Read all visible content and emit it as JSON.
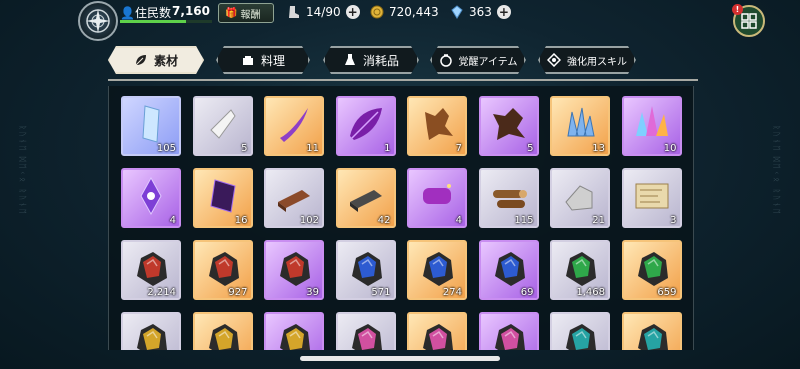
{
  "header": {
    "residents_label": "住民数",
    "residents_value": "7,160",
    "residents_progress": 0.72,
    "reward_label": "報酬",
    "capacity": "14/90",
    "gold": "720,443",
    "gems": "363",
    "notification_badge": "!"
  },
  "tabs": [
    {
      "label": "素材",
      "icon": "leaf-icon"
    },
    {
      "label": "料理",
      "icon": "pot-icon"
    },
    {
      "label": "消耗品",
      "icon": "flask-icon"
    },
    {
      "label": "覚醒アイテム",
      "icon": "awaken-icon"
    },
    {
      "label": "強化用スキル",
      "icon": "skill-icon"
    }
  ],
  "active_tab": 0,
  "items": [
    {
      "name": "crystal-shard",
      "rarity": "blue",
      "count": "105"
    },
    {
      "name": "white-stone",
      "rarity": "white",
      "count": "5"
    },
    {
      "name": "purple-fang",
      "rarity": "orange",
      "count": "11"
    },
    {
      "name": "purple-feather",
      "rarity": "purple",
      "count": "1"
    },
    {
      "name": "brown-pelt",
      "rarity": "orange",
      "count": "7"
    },
    {
      "name": "dark-pelt",
      "rarity": "purple",
      "count": "5"
    },
    {
      "name": "blue-crystals",
      "rarity": "orange",
      "count": "13"
    },
    {
      "name": "rainbow-crystals",
      "rarity": "purple",
      "count": "10"
    },
    {
      "name": "void-gem",
      "rarity": "purple",
      "count": "4"
    },
    {
      "name": "dark-shard",
      "rarity": "orange",
      "count": "16"
    },
    {
      "name": "copper-ingot",
      "rarity": "white",
      "count": "102"
    },
    {
      "name": "iron-ingot",
      "rarity": "orange",
      "count": "42"
    },
    {
      "name": "purple-cloth",
      "rarity": "purple",
      "count": "4"
    },
    {
      "name": "logs",
      "rarity": "white",
      "count": "115"
    },
    {
      "name": "stone-block",
      "rarity": "white",
      "count": "21"
    },
    {
      "name": "scroll",
      "rarity": "white",
      "count": "3"
    },
    {
      "name": "red-ore",
      "rarity": "white",
      "count": "2,214"
    },
    {
      "name": "red-ore-large",
      "rarity": "orange",
      "count": "927"
    },
    {
      "name": "red-ore-glow",
      "rarity": "purple",
      "count": "39"
    },
    {
      "name": "blue-ore",
      "rarity": "white",
      "count": "571"
    },
    {
      "name": "blue-ore-large",
      "rarity": "orange",
      "count": "274"
    },
    {
      "name": "blue-ore-glow",
      "rarity": "purple",
      "count": "69"
    },
    {
      "name": "green-ore",
      "rarity": "white",
      "count": "1,468"
    },
    {
      "name": "green-ore-large",
      "rarity": "orange",
      "count": "659"
    },
    {
      "name": "gold-ore",
      "rarity": "white",
      "count": ""
    },
    {
      "name": "gold-ore-large",
      "rarity": "orange",
      "count": ""
    },
    {
      "name": "gold-ore-glow",
      "rarity": "purple",
      "count": ""
    },
    {
      "name": "pink-ore",
      "rarity": "white",
      "count": ""
    },
    {
      "name": "pink-ore-large",
      "rarity": "orange",
      "count": ""
    },
    {
      "name": "pink-ore-glow",
      "rarity": "purple",
      "count": ""
    },
    {
      "name": "teal-ore",
      "rarity": "white",
      "count": ""
    },
    {
      "name": "teal-ore-large",
      "rarity": "orange",
      "count": ""
    }
  ]
}
